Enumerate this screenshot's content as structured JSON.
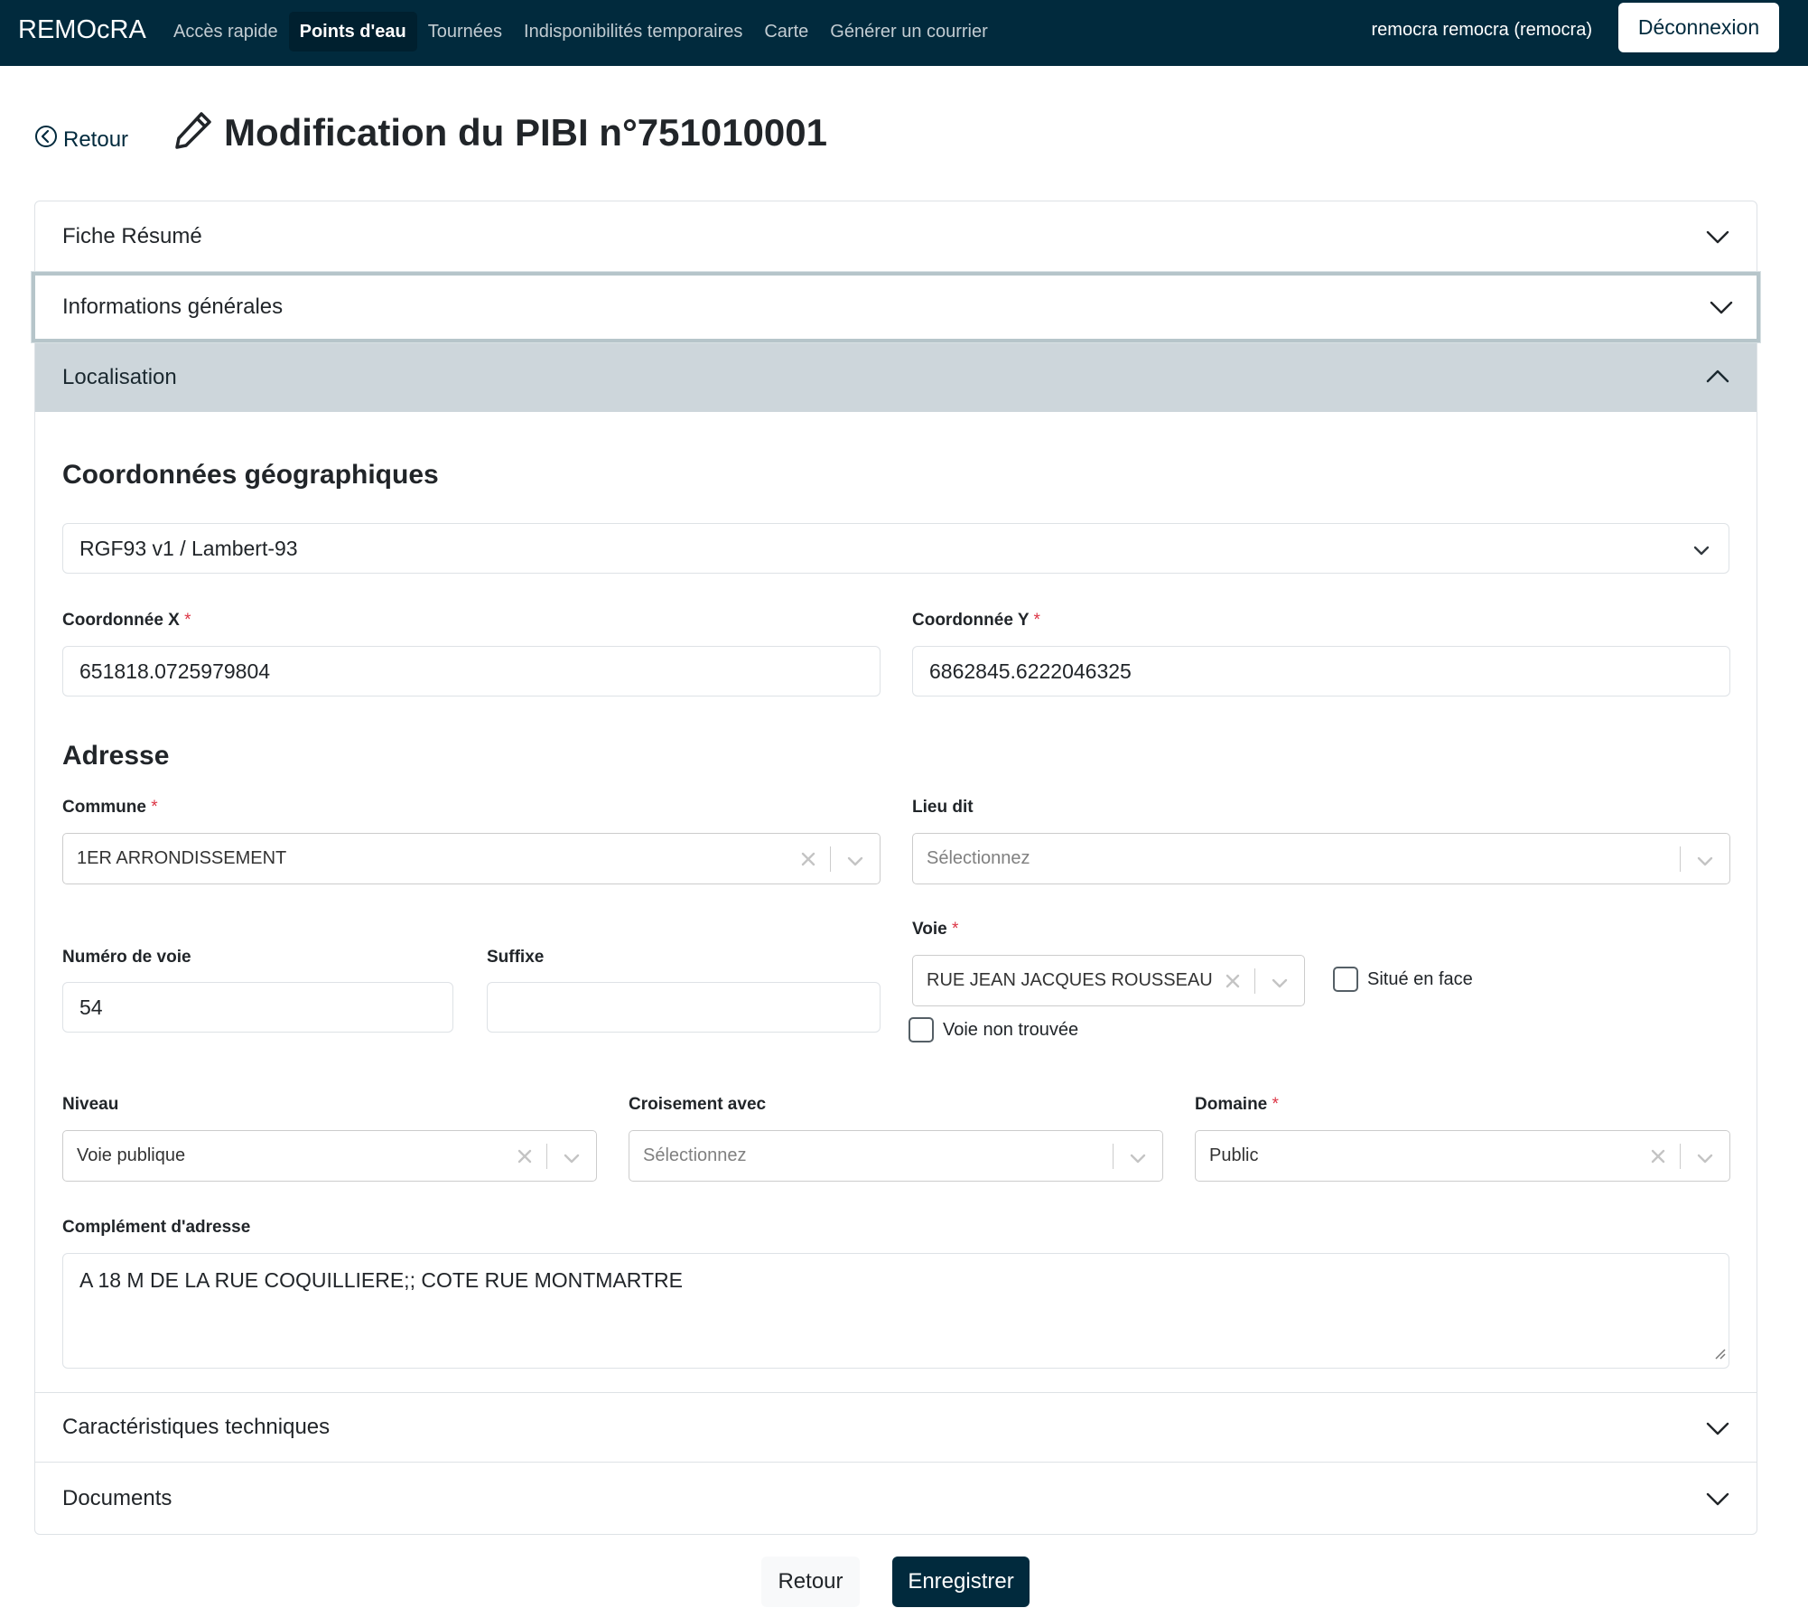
{
  "navbar": {
    "brand": "REMOcRA",
    "links": [
      {
        "label": "Accès rapide"
      },
      {
        "label": "Points d'eau"
      },
      {
        "label": "Tournées"
      },
      {
        "label": "Indisponibilités temporaires"
      },
      {
        "label": "Carte"
      },
      {
        "label": "Générer un courrier"
      }
    ],
    "active_link": "Points d'eau",
    "user": "remocra remocra (remocra)",
    "logout_label": "Déconnexion"
  },
  "header": {
    "back_label": "Retour",
    "title": "Modification du PIBI n°751010001"
  },
  "accordion": {
    "sections": [
      {
        "label": "Fiche Résumé",
        "state": "collapsed"
      },
      {
        "label": "Informations générales",
        "state": "collapsed-focused"
      },
      {
        "label": "Localisation",
        "state": "expanded"
      },
      {
        "label": "Caractéristiques techniques",
        "state": "collapsed"
      },
      {
        "label": "Documents",
        "state": "collapsed"
      }
    ]
  },
  "localisation": {
    "coords_title": "Coordonnées géographiques",
    "projection": "RGF93 v1 / Lambert-93",
    "x_label": "Coordonnée X",
    "x_value": "651818.0725979804",
    "y_label": "Coordonnée Y",
    "y_value": "6862845.6222046325",
    "required_mark": "*",
    "address_title": "Adresse",
    "commune_label": "Commune",
    "commune_value": "1ER ARRONDISSEMENT",
    "lieu_dit_label": "Lieu dit",
    "lieu_dit_placeholder": "Sélectionnez",
    "numero_label": "Numéro de voie",
    "numero_value": "54",
    "suffixe_label": "Suffixe",
    "suffixe_value": "",
    "voie_label": "Voie",
    "voie_value": "RUE JEAN JACQUES ROUSSEAU",
    "situe_en_face_label": "Situé en face",
    "voie_non_trouvee_label": "Voie non trouvée",
    "niveau_label": "Niveau",
    "niveau_value": "Voie publique",
    "croisement_label": "Croisement avec",
    "croisement_placeholder": "Sélectionnez",
    "domaine_label": "Domaine",
    "domaine_value": "Public",
    "complement_label": "Complément d'adresse",
    "complement_value": "A 18 M DE LA RUE COQUILLIERE;; COTE RUE MONTMARTRE"
  },
  "footer": {
    "back_label": "Retour",
    "save_label": "Enregistrer"
  },
  "colors": {
    "navbar_bg": "#012a3d",
    "primary": "#012a3d",
    "accordion_open_bg": "#cdd6db",
    "required": "#dc3545"
  },
  "icons": {
    "back": "chevron-left-circle-icon",
    "edit": "pencil-icon",
    "accordion": "chevron-down-icon",
    "clear": "x-icon"
  }
}
